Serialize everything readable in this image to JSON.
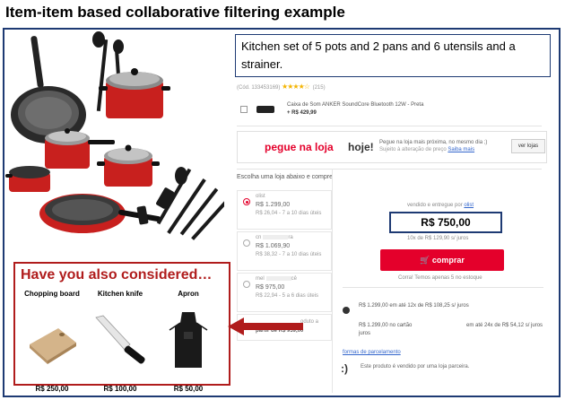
{
  "title": "Item-item based collaborative filtering example",
  "description": "Kitchen set of 5 pots and 2 pans and 6 utensils and a strainer.",
  "product": {
    "code": "(Cód. 133453169)",
    "stars": "★★★★☆",
    "review_count": "(215)"
  },
  "addon": {
    "name": "Caixa de Som ANKER SoundCore Bluetooth 12W - Preta",
    "price": "+ R$ 429,99"
  },
  "pickup": {
    "headline_red": "pegue na loja",
    "headline_dark": "hoje!",
    "line1": "Pegue na loja mais próxima, no mesmo dia ;)",
    "line2": "Sujeito à alteração de preço",
    "link": "Saiba mais",
    "button": "ver lojas"
  },
  "stores_heading": "Escolha uma loja abaixo e compre",
  "stores": [
    {
      "name": "olist",
      "price": "R$ 1.299,00",
      "installments": "R$ 26,04 - 7 a 10 dias úteis",
      "selected": true
    },
    {
      "name": "cn",
      "name_end": "ra",
      "price": "R$ 1.069,90",
      "installments": "R$ 38,32 - 7 a 10 dias úteis",
      "selected": false
    },
    {
      "name": "mel",
      "name_end": "cê",
      "price": "R$ 975,00",
      "installments": "R$ 22,94 - 5 a 6 dias úteis",
      "selected": false
    }
  ],
  "last_store": {
    "line1": "oduto a",
    "line2": "partir de R$ 959,00"
  },
  "seller_prefix": "vendido e entregue por",
  "seller": "olist",
  "price": "R$ 750,00",
  "price_sub": "10x de R$ 129,90 s/ juros",
  "buy_button": "comprar",
  "stock_note": "Corra! Temos apenas 5 no estoque",
  "payments": [
    {
      "left": "R$ 1.299,00 em até 12x de R$ 108,25 s/ juros",
      "right": ""
    },
    {
      "left": "R$ 1.299,00 no cartão",
      "right": "em até 24x de R$ 54,12 s/ juros"
    }
  ],
  "payments_wrap": "juros",
  "parcel_link": "formas de parcelamento",
  "smile": ":)",
  "partner_note": "Este produto é vendido por uma loja parceira.",
  "suggestions": {
    "heading": "Have you also considered…",
    "items": [
      {
        "name": "Chopping board",
        "price": "R$ 250,00"
      },
      {
        "name": "Kitchen knife",
        "price": "R$ 100,00"
      },
      {
        "name": "Apron",
        "price": "R$ 50,00"
      }
    ]
  },
  "colors": {
    "frame": "#1e3a73",
    "accent_red": "#e4002b",
    "suggest_red": "#b01c1c",
    "pot_red": "#c8201e"
  }
}
